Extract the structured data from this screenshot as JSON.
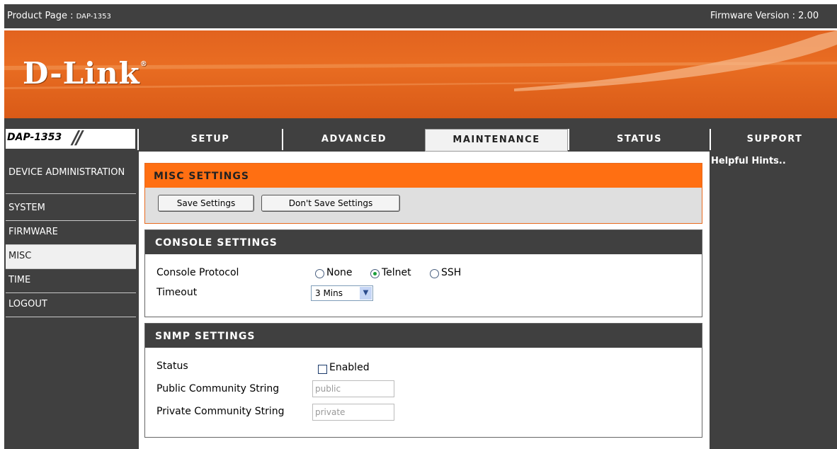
{
  "header": {
    "product_label": "Product Page : ",
    "product_model": "DAP-1353",
    "firmware": "Firmware Version : 2.00"
  },
  "brand": {
    "logo": "D-Link",
    "trademark": "®"
  },
  "model_badge": {
    "label": "DAP-1353",
    "slashes": "//"
  },
  "nav": {
    "tabs": [
      {
        "label": "SETUP"
      },
      {
        "label": "ADVANCED"
      },
      {
        "label": "MAINTENANCE",
        "active": true
      },
      {
        "label": "STATUS"
      },
      {
        "label": "SUPPORT"
      }
    ]
  },
  "sidebar": {
    "items": [
      {
        "label": "DEVICE ADMINISTRATION"
      },
      {
        "label": "SYSTEM"
      },
      {
        "label": "FIRMWARE"
      },
      {
        "label": "MISC",
        "active": true
      },
      {
        "label": "TIME"
      },
      {
        "label": "LOGOUT"
      }
    ]
  },
  "misc": {
    "title": "MISC SETTINGS",
    "save_label": "Save Settings",
    "dont_save_label": "Don't Save Settings"
  },
  "console": {
    "title": "CONSOLE SETTINGS",
    "protocol_label": "Console Protocol",
    "options": [
      "None",
      "Telnet",
      "SSH"
    ],
    "selected": "Telnet",
    "timeout_label": "Timeout",
    "timeout_value": "3 Mins"
  },
  "snmp": {
    "title": "SNMP SETTINGS",
    "status_label": "Status",
    "enabled_label": "Enabled",
    "enabled": false,
    "public_label": "Public Community String",
    "public_value": "public",
    "private_label": "Private Community String",
    "private_value": "private"
  },
  "hints": {
    "title": "Helpful Hints.."
  },
  "colors": {
    "accent": "#ff6f12",
    "dark": "#404040",
    "banner": "#e2631f"
  }
}
